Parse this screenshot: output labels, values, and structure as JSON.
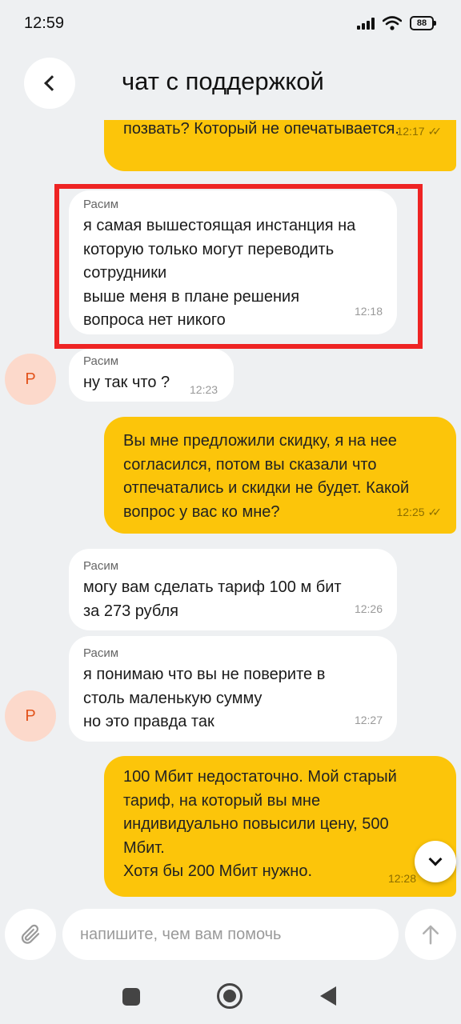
{
  "status_bar": {
    "time": "12:59",
    "battery": "88"
  },
  "header": {
    "title": "чат с поддержкой"
  },
  "messages": [
    {
      "direction": "out",
      "text": "позвать? Который не опечатывается.",
      "time": "12:17",
      "read": true
    },
    {
      "direction": "in",
      "sender": "Расим",
      "text": "я самая вышестоящая инстанция на\nкоторую только могут переводить\nсотрудники\nвыше меня в плане решения\nвопроса нет никого",
      "time": "12:18",
      "highlighted": true
    },
    {
      "direction": "in",
      "sender": "Расим",
      "text": "ну так что ?",
      "time": "12:23",
      "avatar": "Р"
    },
    {
      "direction": "out",
      "text": "Вы мне предложили скидку, я на нее\nсогласился, потом вы сказали что\nотпечатались и скидки не будет. Какой\nвопрос у вас ко мне?",
      "time": "12:25",
      "read": true
    },
    {
      "direction": "in",
      "sender": "Расим",
      "text": "могу вам сделать тариф 100 м бит\nза 273 рубля",
      "time": "12:26"
    },
    {
      "direction": "in",
      "sender": "Расим",
      "text": "я понимаю что вы не поверите в\nстоль маленькую сумму\nно это правда так",
      "time": "12:27",
      "avatar": "Р"
    },
    {
      "direction": "out",
      "text": "100 Мбит недостаточно. Мой старый\nтариф, на который вы мне\nиндивидуально повысили цену, 500\nМбит.\nХотя бы 200 Мбит нужно.",
      "time": "12:28"
    }
  ],
  "input": {
    "placeholder": "напишите, чем вам помочь"
  },
  "icons": {
    "back": "chevron-left-icon",
    "attach": "paperclip-icon",
    "send": "arrow-up-icon",
    "scroll_down": "chevron-down-icon",
    "read_receipt": "double-check-icon"
  },
  "colors": {
    "accent": "#fcc50a",
    "background": "#eef0f2",
    "highlight": "#ee2424",
    "avatar_bg": "#fcd9cb",
    "avatar_text": "#e2531b"
  }
}
